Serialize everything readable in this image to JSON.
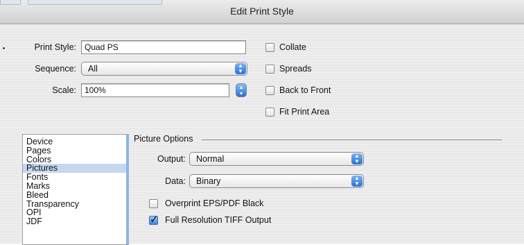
{
  "window": {
    "title": "Edit Print Style"
  },
  "form": {
    "print_style_label": "Print Style:",
    "print_style_value": "Quad PS",
    "sequence_label": "Sequence:",
    "sequence_value": "All",
    "scale_label": "Scale:",
    "scale_value": "100%"
  },
  "options": {
    "collate": {
      "label": "Collate",
      "checked": false
    },
    "spreads": {
      "label": "Spreads",
      "checked": false
    },
    "back_to_front": {
      "label": "Back to Front",
      "checked": false
    },
    "fit_print_area": {
      "label": "Fit Print Area",
      "checked": false
    }
  },
  "categories": {
    "items": [
      "Device",
      "Pages",
      "Colors",
      "Pictures",
      "Fonts",
      "Marks",
      "Bleed",
      "Transparency",
      "OPI",
      "JDF"
    ],
    "selected": "Pictures"
  },
  "picture_options": {
    "title": "Picture Options",
    "output_label": "Output:",
    "output_value": "Normal",
    "data_label": "Data:",
    "data_value": "Binary",
    "overprint": {
      "label": "Overprint EPS/PDF Black",
      "checked": false
    },
    "full_res_tiff": {
      "label": "Full Resolution TIFF Output",
      "checked": true
    }
  },
  "colors": {
    "accent": "#2a6fd6",
    "selection": "#c7d7ef"
  }
}
